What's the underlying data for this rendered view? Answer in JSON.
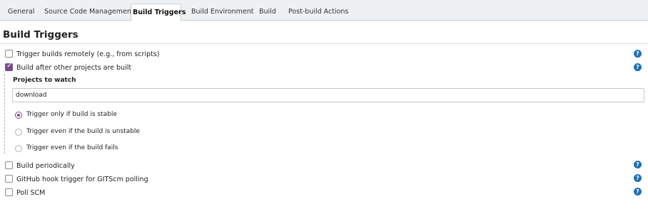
{
  "tabs": [
    {
      "label": "General"
    },
    {
      "label": "Source Code Management"
    },
    {
      "label": "Build Triggers",
      "active": true
    },
    {
      "label": "Build Environment"
    },
    {
      "label": "Build"
    },
    {
      "label": "Post-build Actions"
    }
  ],
  "section": {
    "title": "Build Triggers"
  },
  "triggers": {
    "remote": {
      "label": "Trigger builds remotely (e.g., from scripts)",
      "checked": false,
      "help": "?"
    },
    "after_other": {
      "label": "Build after other projects are built",
      "checked": true,
      "help": "?"
    },
    "periodic": {
      "label": "Build periodically",
      "checked": false,
      "help": "?"
    },
    "github_hook": {
      "label": "GitHub hook trigger for GITScm polling",
      "checked": false,
      "help": "?"
    },
    "poll_scm": {
      "label": "Poll SCM",
      "checked": false,
      "help": "?"
    }
  },
  "projects_to_watch": {
    "label": "Projects to watch",
    "value": "download"
  },
  "trigger_options": [
    {
      "label": "Trigger only if build is stable",
      "selected": true
    },
    {
      "label": "Trigger even if the build is unstable",
      "selected": false
    },
    {
      "label": "Trigger even if the build fails",
      "selected": false
    }
  ],
  "colors": {
    "accent": "#7a4b8c",
    "help": "#1f6fb5",
    "tabbar": "#eef1f2"
  }
}
